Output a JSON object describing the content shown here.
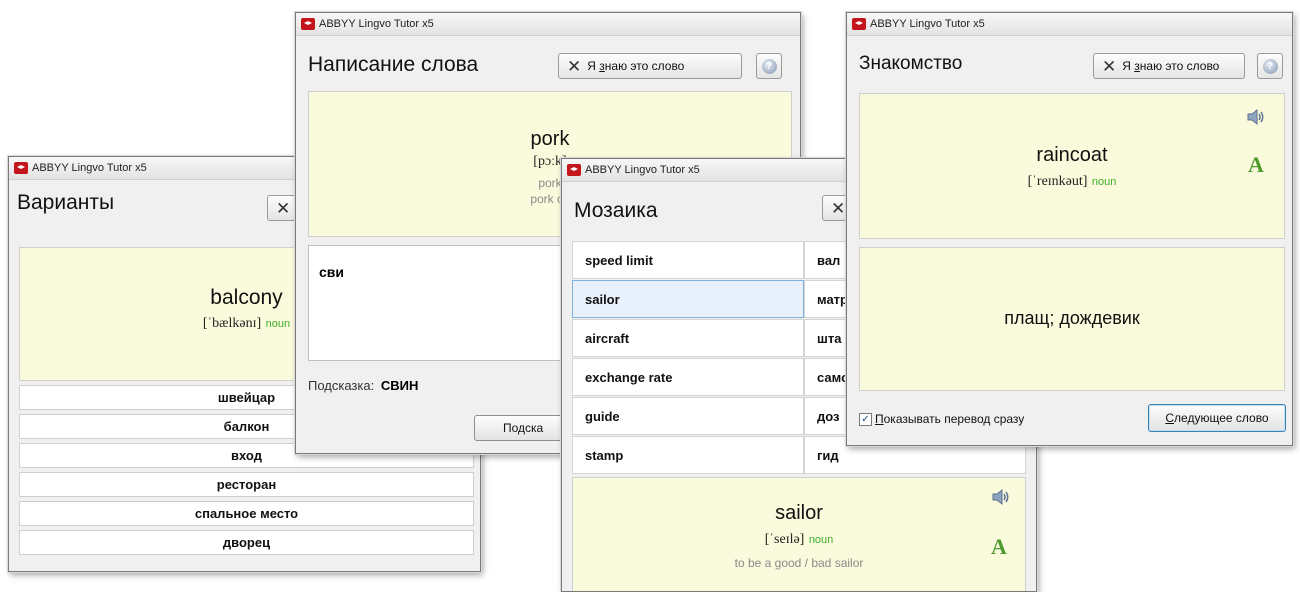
{
  "app_title": "ABBYY Lingvo Tutor x5",
  "know_label_pre": "Я ",
  "know_label_u": "з",
  "know_label_post": "наю это слово",
  "help_glyph": "?",
  "varianty": {
    "heading": "Варианты",
    "word": "balcony",
    "transcription": "[ˈbælkənɪ]",
    "pos": "noun",
    "options": [
      "швейцар",
      "балкон",
      "вход",
      "ресторан",
      "спальное место",
      "дворец"
    ]
  },
  "napisanie": {
    "heading": "Написание слова",
    "word": "pork",
    "transcription": "[pɔːk]",
    "line1": "pork",
    "line2": "pork ch",
    "typed": "сви",
    "hint_label": "Подсказка:",
    "hint_value": "СВИН",
    "hint_button": "Подска"
  },
  "mozaika": {
    "heading": "Мозаика",
    "left_items": [
      "speed limit",
      "sailor",
      "aircraft",
      "exchange rate",
      "guide",
      "stamp"
    ],
    "right_items": [
      "вал",
      "матр",
      "шта",
      "само",
      "доз",
      "гид"
    ],
    "selected_index": 1,
    "word": "sailor",
    "transcription": "[ˈseɪlə]",
    "pos": "noun",
    "example": "to be a good / bad sailor"
  },
  "znakomstvo": {
    "heading": "Знакомство",
    "word": "raincoat",
    "transcription": "[ˈreɪnkəut]",
    "pos": "noun",
    "translation": "плащ; дождевик",
    "checkbox_label_u": "П",
    "checkbox_label_rest": "оказывать перевод сразу",
    "checkbox_checked": true,
    "next_pre": "",
    "next_u": "С",
    "next_post": "ледующее слово"
  },
  "icon_names": [
    "app-icon",
    "close-x-icon",
    "help-icon",
    "speaker-icon",
    "letter-a-icon",
    "checkbox-icon"
  ],
  "colors": {
    "card_bg": "#fafadc",
    "pos_green": "#3fae2a",
    "app_red": "#c4161c",
    "selected_border": "#7fb1e0"
  }
}
